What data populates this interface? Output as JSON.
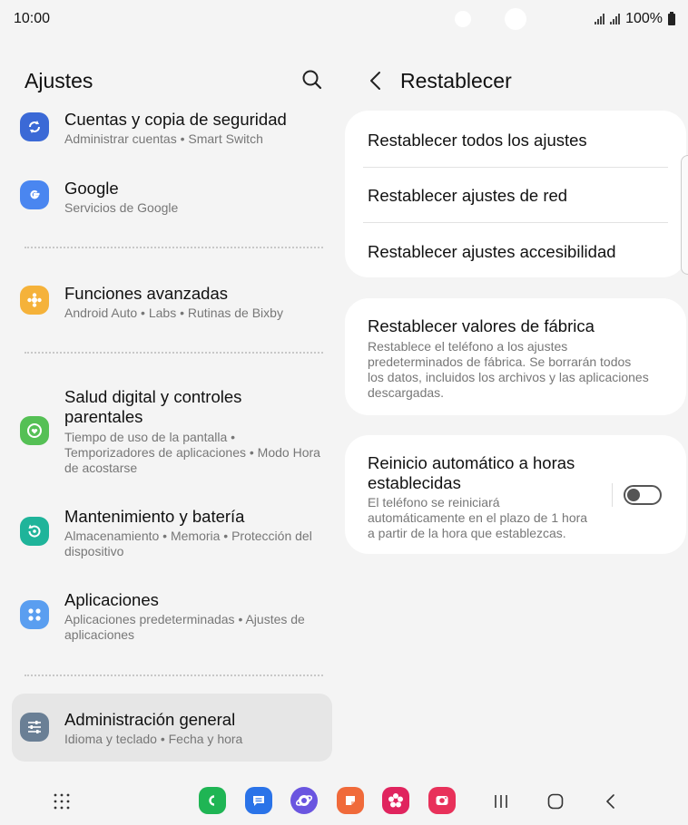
{
  "status": {
    "time": "10:00",
    "battery": "100%"
  },
  "left": {
    "title": "Ajustes",
    "items": [
      {
        "title": "Cuentas y copia de seguridad",
        "subtitle": "Administrar cuentas  •  Smart Switch",
        "color": "#3b69d6",
        "icon": "sync-icon"
      },
      {
        "title": "Google",
        "subtitle": "Servicios de Google",
        "color": "#4a86f0",
        "icon": "google-icon"
      },
      {
        "title": "Funciones avanzadas",
        "subtitle": "Android Auto  •  Labs  •  Rutinas de Bixby",
        "color": "#f5b23a",
        "icon": "puzzle-icon"
      },
      {
        "title": "Salud digital y controles parentales",
        "subtitle": "Tiempo de uso de la pantalla  •  Temporizadores de aplicaciones  •  Modo Hora de acostarse",
        "color": "#55c055",
        "icon": "heart-circle-icon"
      },
      {
        "title": "Mantenimiento y batería",
        "subtitle": "Almacenamiento  •  Memoria  •  Protección del dispositivo",
        "color": "#1fb49a",
        "icon": "refresh-icon"
      },
      {
        "title": "Aplicaciones",
        "subtitle": "Aplicaciones predeterminadas  •  Ajustes de aplicaciones",
        "color": "#5a9ef0",
        "icon": "apps-icon"
      },
      {
        "title": "Administración general",
        "subtitle": "Idioma y teclado  •  Fecha y hora",
        "color": "#6a7f95",
        "icon": "sliders-icon"
      }
    ]
  },
  "right": {
    "title": "Restablecer",
    "card1": [
      "Restablecer todos los ajustes",
      "Restablecer ajustes de red",
      "Restablecer ajustes accesibilidad"
    ],
    "factory": {
      "title": "Restablecer valores de fábrica",
      "desc": [
        "Restablece el teléfono a los ajustes",
        "predeterminados de fábrica. Se borrarán todos",
        "los datos, incluidos los archivos y las aplicaciones",
        "descargadas."
      ]
    },
    "auto": {
      "title": [
        "Reinicio automático a horas",
        "establecidas"
      ],
      "desc": [
        "El teléfono se reiniciará",
        "automáticamente en el plazo de 1 hora",
        "a partir de la hora que establezcas."
      ],
      "enabled": false
    }
  },
  "dock": {
    "apps": [
      {
        "name": "phone",
        "color": "#1fb554"
      },
      {
        "name": "messages",
        "color": "#2a73e8"
      },
      {
        "name": "internet",
        "color": "#6a55e0"
      },
      {
        "name": "notes",
        "color": "#f06a3a"
      },
      {
        "name": "gallery",
        "color": "#e0245e"
      },
      {
        "name": "camera",
        "color": "#e8315a"
      }
    ]
  }
}
